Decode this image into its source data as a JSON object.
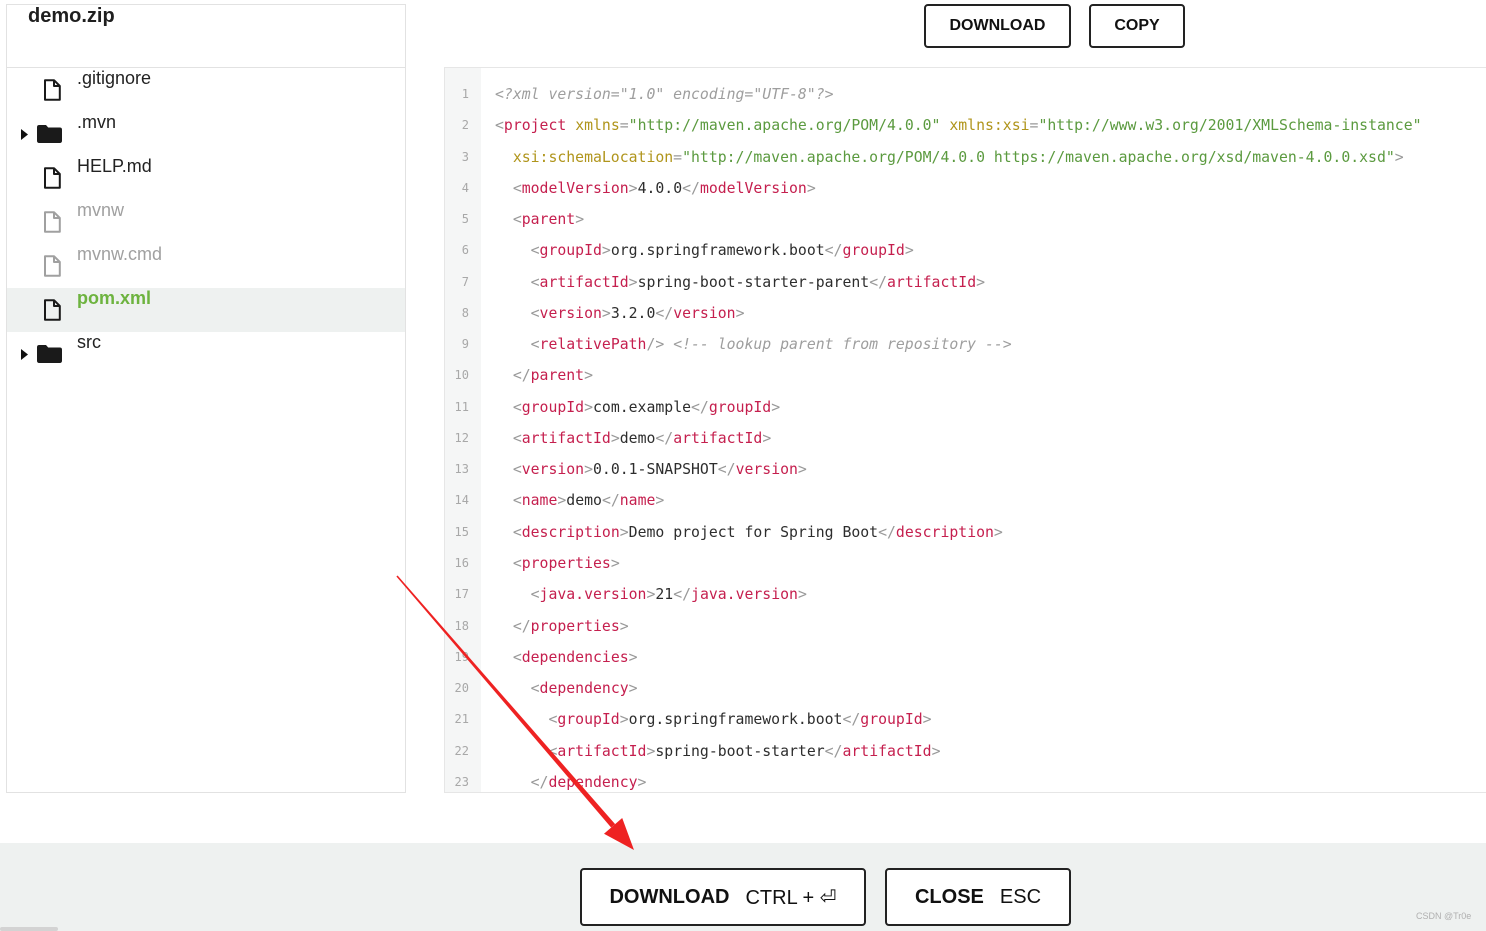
{
  "sidebar": {
    "title": "demo.zip",
    "caret_icon": "caret-right-icon",
    "items": [
      {
        "name": ".gitignore",
        "icon": "file-icon"
      },
      {
        "name": ".mvn",
        "icon": "folder-icon",
        "expandable": true
      },
      {
        "name": "HELP.md",
        "icon": "file-icon"
      },
      {
        "name": "mvnw",
        "icon": "file-icon",
        "dimmed": true
      },
      {
        "name": "mvnw.cmd",
        "icon": "file-icon",
        "dimmed": true
      },
      {
        "name": "pom.xml",
        "icon": "file-icon",
        "selected": true
      },
      {
        "name": "src",
        "icon": "folder-icon",
        "expandable": true
      }
    ]
  },
  "toolbar": {
    "download_label": "DOWNLOAD",
    "copy_label": "COPY"
  },
  "editor": {
    "lines": [
      {
        "n": "1",
        "indent": 0,
        "tokens": [
          {
            "prolog": "<?xml version=\"1.0\" encoding=\"UTF-8\"?>"
          }
        ]
      },
      {
        "n": "2",
        "indent": 0,
        "tokens": [
          {
            "punct": "<"
          },
          {
            "tag": "project"
          },
          {
            "attr": " xmlns"
          },
          {
            "punct": "="
          },
          {
            "value": "\"http://maven.apache.org/POM/4.0.0\""
          },
          {
            "attr": " xmlns:xsi"
          },
          {
            "punct": "="
          },
          {
            "value": "\"http://www.w3.org/2001/XMLSchema-instance\""
          }
        ]
      },
      {
        "n": "3",
        "indent": 2,
        "tokens": [
          {
            "attr": "xsi:schemaLocation"
          },
          {
            "punct": "="
          },
          {
            "value": "\"http://maven.apache.org/POM/4.0.0 https://maven.apache.org/xsd/maven-4.0.0.xsd\""
          },
          {
            "punct": ">"
          }
        ]
      },
      {
        "n": "4",
        "indent": 2,
        "tokens": [
          {
            "punct": "<"
          },
          {
            "tag": "modelVersion"
          },
          {
            "punct": ">"
          },
          {
            "text": "4.0.0"
          },
          {
            "punct": "</"
          },
          {
            "tag": "modelVersion"
          },
          {
            "punct": ">"
          }
        ]
      },
      {
        "n": "5",
        "indent": 2,
        "tokens": [
          {
            "punct": "<"
          },
          {
            "tag": "parent"
          },
          {
            "punct": ">"
          }
        ]
      },
      {
        "n": "6",
        "indent": 4,
        "tokens": [
          {
            "punct": "<"
          },
          {
            "tag": "groupId"
          },
          {
            "punct": ">"
          },
          {
            "text": "org.springframework.boot"
          },
          {
            "punct": "</"
          },
          {
            "tag": "groupId"
          },
          {
            "punct": ">"
          }
        ]
      },
      {
        "n": "7",
        "indent": 4,
        "tokens": [
          {
            "punct": "<"
          },
          {
            "tag": "artifactId"
          },
          {
            "punct": ">"
          },
          {
            "text": "spring-boot-starter-parent"
          },
          {
            "punct": "</"
          },
          {
            "tag": "artifactId"
          },
          {
            "punct": ">"
          }
        ]
      },
      {
        "n": "8",
        "indent": 4,
        "tokens": [
          {
            "punct": "<"
          },
          {
            "tag": "version"
          },
          {
            "punct": ">"
          },
          {
            "text": "3.2.0"
          },
          {
            "punct": "</"
          },
          {
            "tag": "version"
          },
          {
            "punct": ">"
          }
        ]
      },
      {
        "n": "9",
        "indent": 4,
        "tokens": [
          {
            "punct": "<"
          },
          {
            "tag": "relativePath"
          },
          {
            "punct": "/>"
          },
          {
            "comment": " <!-- lookup parent from repository -->"
          }
        ]
      },
      {
        "n": "10",
        "indent": 2,
        "tokens": [
          {
            "punct": "</"
          },
          {
            "tag": "parent"
          },
          {
            "punct": ">"
          }
        ]
      },
      {
        "n": "11",
        "indent": 2,
        "tokens": [
          {
            "punct": "<"
          },
          {
            "tag": "groupId"
          },
          {
            "punct": ">"
          },
          {
            "text": "com.example"
          },
          {
            "punct": "</"
          },
          {
            "tag": "groupId"
          },
          {
            "punct": ">"
          }
        ]
      },
      {
        "n": "12",
        "indent": 2,
        "tokens": [
          {
            "punct": "<"
          },
          {
            "tag": "artifactId"
          },
          {
            "punct": ">"
          },
          {
            "text": "demo"
          },
          {
            "punct": "</"
          },
          {
            "tag": "artifactId"
          },
          {
            "punct": ">"
          }
        ]
      },
      {
        "n": "13",
        "indent": 2,
        "tokens": [
          {
            "punct": "<"
          },
          {
            "tag": "version"
          },
          {
            "punct": ">"
          },
          {
            "text": "0.0.1-SNAPSHOT"
          },
          {
            "punct": "</"
          },
          {
            "tag": "version"
          },
          {
            "punct": ">"
          }
        ]
      },
      {
        "n": "14",
        "indent": 2,
        "tokens": [
          {
            "punct": "<"
          },
          {
            "tag": "name"
          },
          {
            "punct": ">"
          },
          {
            "text": "demo"
          },
          {
            "punct": "</"
          },
          {
            "tag": "name"
          },
          {
            "punct": ">"
          }
        ]
      },
      {
        "n": "15",
        "indent": 2,
        "tokens": [
          {
            "punct": "<"
          },
          {
            "tag": "description"
          },
          {
            "punct": ">"
          },
          {
            "text": "Demo project for Spring Boot"
          },
          {
            "punct": "</"
          },
          {
            "tag": "description"
          },
          {
            "punct": ">"
          }
        ]
      },
      {
        "n": "16",
        "indent": 2,
        "tokens": [
          {
            "punct": "<"
          },
          {
            "tag": "properties"
          },
          {
            "punct": ">"
          }
        ]
      },
      {
        "n": "17",
        "indent": 4,
        "tokens": [
          {
            "punct": "<"
          },
          {
            "tag": "java.version"
          },
          {
            "punct": ">"
          },
          {
            "text": "21"
          },
          {
            "punct": "</"
          },
          {
            "tag": "java.version"
          },
          {
            "punct": ">"
          }
        ]
      },
      {
        "n": "18",
        "indent": 2,
        "tokens": [
          {
            "punct": "</"
          },
          {
            "tag": "properties"
          },
          {
            "punct": ">"
          }
        ]
      },
      {
        "n": "19",
        "indent": 2,
        "tokens": [
          {
            "punct": "<"
          },
          {
            "tag": "dependencies"
          },
          {
            "punct": ">"
          }
        ]
      },
      {
        "n": "20",
        "indent": 4,
        "tokens": [
          {
            "punct": "<"
          },
          {
            "tag": "dependency"
          },
          {
            "punct": ">"
          }
        ]
      },
      {
        "n": "21",
        "indent": 6,
        "tokens": [
          {
            "punct": "<"
          },
          {
            "tag": "groupId"
          },
          {
            "punct": ">"
          },
          {
            "text": "org.springframework.boot"
          },
          {
            "punct": "</"
          },
          {
            "tag": "groupId"
          },
          {
            "punct": ">"
          }
        ]
      },
      {
        "n": "22",
        "indent": 6,
        "tokens": [
          {
            "punct": "<"
          },
          {
            "tag": "artifactId"
          },
          {
            "punct": ">"
          },
          {
            "text": "spring-boot-starter"
          },
          {
            "punct": "</"
          },
          {
            "tag": "artifactId"
          },
          {
            "punct": ">"
          }
        ]
      },
      {
        "n": "23",
        "indent": 4,
        "tokens": [
          {
            "punct": "</"
          },
          {
            "tag": "dependency"
          },
          {
            "punct": ">"
          }
        ]
      }
    ]
  },
  "footer": {
    "download": {
      "label": "DOWNLOAD",
      "shortcut": "CTRL + ⏎"
    },
    "close": {
      "label": "CLOSE",
      "shortcut": "ESC"
    }
  },
  "watermark": "CSDN @Tr0e",
  "colors": {
    "text": "#222222",
    "muted": "#a0a0a0",
    "accent": "#6db33f",
    "selected_row": "#eef1f0",
    "footer_bg": "#eef1f0",
    "annotation": "#ee2222",
    "syntax": {
      "punct": "#999999",
      "tag": "#c51f4e",
      "attr": "#b0951c",
      "value": "#5b9a3f",
      "text": "#2d2d2d",
      "comment": "#9e9e9e",
      "prolog": "#9e9e9e"
    }
  }
}
